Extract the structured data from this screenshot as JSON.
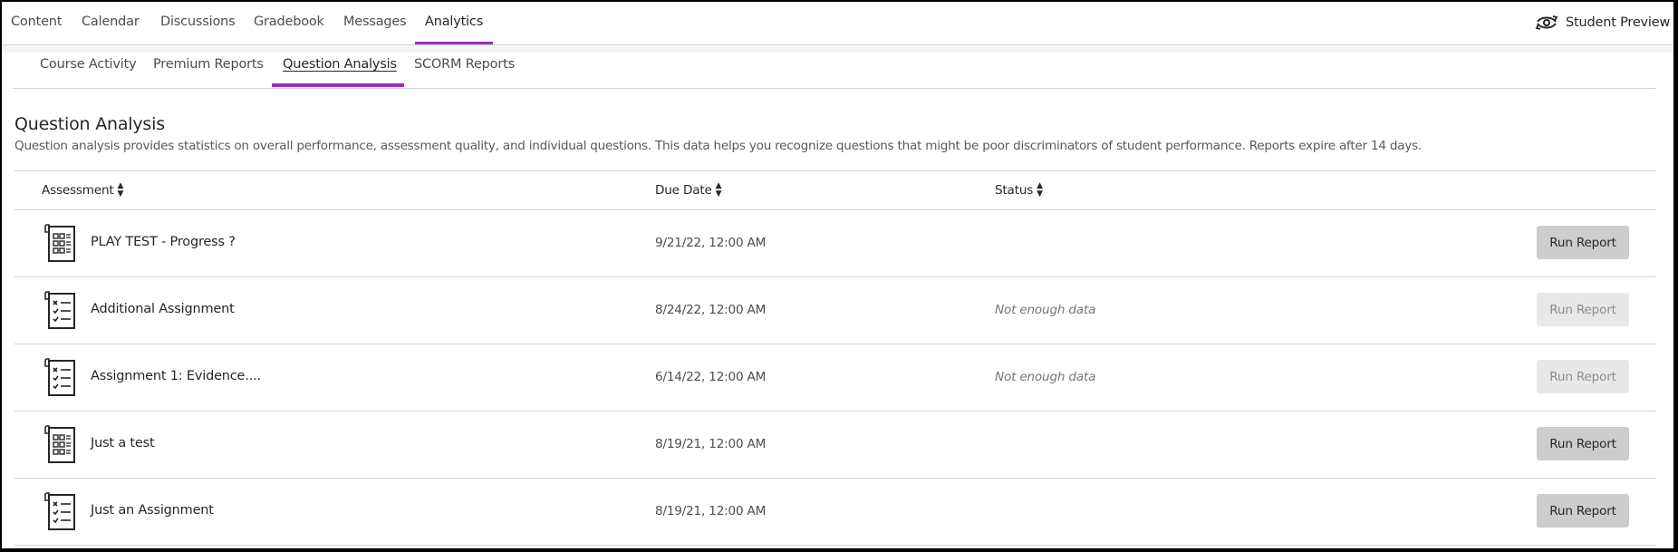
{
  "top_nav": {
    "items": [
      {
        "label": "Content",
        "active": false
      },
      {
        "label": "Calendar",
        "active": false
      },
      {
        "label": "Discussions",
        "active": false
      },
      {
        "label": "Gradebook",
        "active": false
      },
      {
        "label": "Messages",
        "active": false
      },
      {
        "label": "Analytics",
        "active": true
      }
    ],
    "student_preview_label": "Student Preview",
    "student_preview_icon": "eye-refresh-icon",
    "accent_color": "#9b2db8"
  },
  "sub_nav": {
    "items": [
      {
        "label": "Course Activity",
        "active": false
      },
      {
        "label": "Premium Reports",
        "active": false
      },
      {
        "label": "Question Analysis",
        "active": true
      },
      {
        "label": "SCORM Reports",
        "active": false
      }
    ]
  },
  "page": {
    "title": "Question Analysis",
    "description": "Question analysis provides statistics on overall performance, assessment quality, and individual questions. This data helps you recognize questions that might be poor discriminators of student performance. Reports expire after 14 days."
  },
  "table": {
    "columns": [
      {
        "label": "Assessment",
        "sort_icon": "sort-icon"
      },
      {
        "label": "Due Date",
        "sort_icon": "sort-icon"
      },
      {
        "label": "Status",
        "sort_icon": "sort-icon"
      }
    ],
    "rows": [
      {
        "icon": "test-icon",
        "name": "PLAY TEST - Progress ?",
        "due_date": "9/21/22, 12:00 AM",
        "status": "",
        "button": "Run Report",
        "button_enabled": true
      },
      {
        "icon": "assignment-icon",
        "name": "Additional Assignment",
        "due_date": "8/24/22, 12:00 AM",
        "status": "Not enough data",
        "button": "Run Report",
        "button_enabled": false
      },
      {
        "icon": "assignment-icon",
        "name": "Assignment 1: Evidence....",
        "due_date": "6/14/22, 12:00 AM",
        "status": "Not enough data",
        "button": "Run Report",
        "button_enabled": false
      },
      {
        "icon": "test-icon",
        "name": "Just a test",
        "due_date": "8/19/21, 12:00 AM",
        "status": "",
        "button": "Run Report",
        "button_enabled": true
      },
      {
        "icon": "assignment-icon",
        "name": "Just an Assignment",
        "due_date": "8/19/21, 12:00 AM",
        "status": "",
        "button": "Run Report",
        "button_enabled": true
      }
    ]
  }
}
